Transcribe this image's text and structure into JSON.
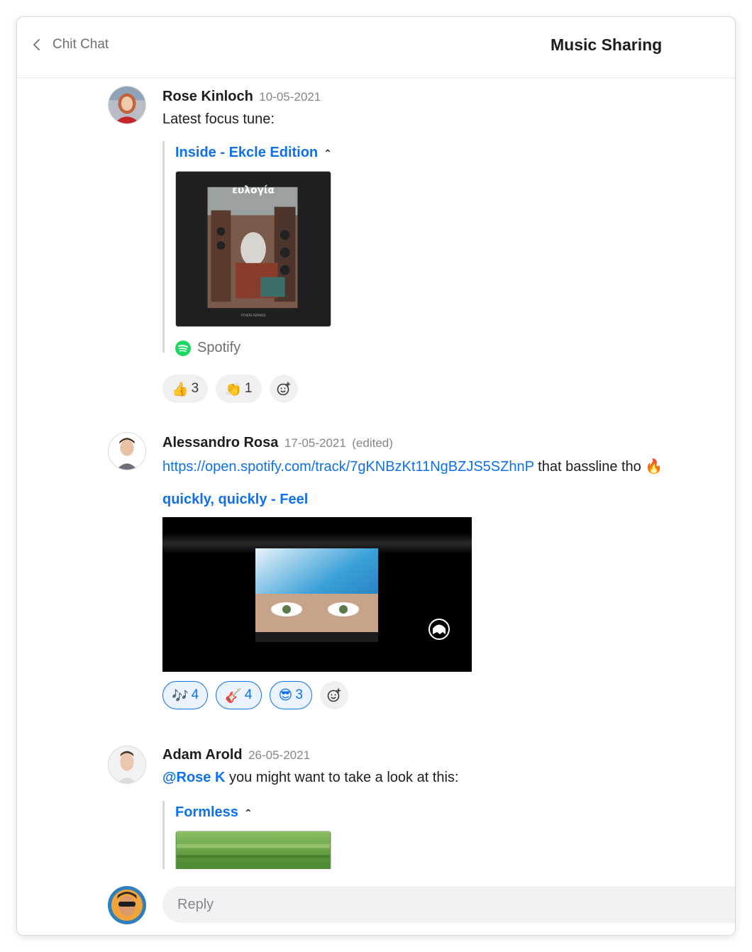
{
  "header": {
    "back_label": "Chit Chat",
    "title": "Music Sharing"
  },
  "messages": [
    {
      "author": "Rose Kinloch",
      "date": "10-05-2021",
      "text": "Latest focus tune:",
      "embed": {
        "title": "Inside - Ekcle Edition",
        "album_title": "ευλογία",
        "album_subtitle": "OTHERS REMIXES",
        "provider": "Spotify"
      },
      "reactions": [
        {
          "emoji": "👍",
          "count": "3",
          "active": false
        },
        {
          "emoji": "👏",
          "count": "1",
          "active": false
        }
      ]
    },
    {
      "author": "Alessandro Rosa",
      "date": "17-05-2021",
      "edited": "(edited)",
      "link": "https://open.spotify.com/track/7gKNBzKt11NgBZJS5SZhnP",
      "text_after": " that bassline tho 🔥",
      "embed": {
        "title": "quickly, quickly - Feel"
      },
      "reactions": [
        {
          "emoji": "🎶",
          "count": "4",
          "active": true
        },
        {
          "emoji": "🎸",
          "count": "4",
          "active": true
        },
        {
          "emoji": "😎",
          "count": "3",
          "active": true
        }
      ]
    },
    {
      "author": "Adam Arold",
      "date": "26-05-2021",
      "mention": "@Rose K",
      "text_after": " you might want to take a look at this:",
      "embed": {
        "title": "Formless"
      }
    }
  ],
  "reply": {
    "placeholder": "Reply"
  },
  "colors": {
    "accent": "#0e71eb",
    "spotify": "#1ed760"
  }
}
